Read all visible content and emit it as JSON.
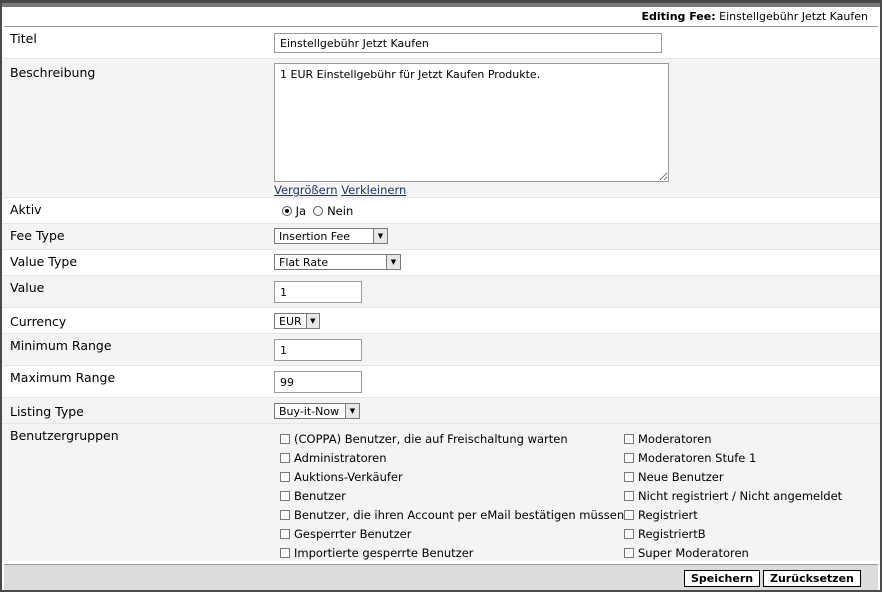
{
  "header": {
    "prefix": "Editing Fee:",
    "name": "Einstellgebühr Jetzt Kaufen"
  },
  "titel": {
    "label": "Titel",
    "value": "Einstellgebühr Jetzt Kaufen"
  },
  "beschreibung": {
    "label": "Beschreibung",
    "value": "1 EUR Einstellgebühr für Jetzt Kaufen Produkte.",
    "enlarge": "Vergrößern",
    "shrink": "Verkleinern"
  },
  "aktiv": {
    "label": "Aktiv",
    "yes": "Ja",
    "no": "Nein",
    "selected": "Ja"
  },
  "fee_type": {
    "label": "Fee Type",
    "value": "Insertion Fee"
  },
  "value_type": {
    "label": "Value Type",
    "value": "Flat Rate"
  },
  "value": {
    "label": "Value",
    "value": "1"
  },
  "currency": {
    "label": "Currency",
    "value": "EUR"
  },
  "min_range": {
    "label": "Minimum Range",
    "value": "1"
  },
  "max_range": {
    "label": "Maximum Range",
    "value": "99"
  },
  "listing_type": {
    "label": "Listing Type",
    "value": "Buy-it-Now"
  },
  "groups": {
    "label": "Benutzergruppen",
    "left": [
      "(COPPA) Benutzer, die auf Freischaltung warten",
      "Administratoren",
      "Auktions-Verkäufer",
      "Benutzer",
      "Benutzer, die ihren Account per eMail bestätigen müssen",
      "Gesperrter Benutzer",
      "Importierte gesperrte Benutzer"
    ],
    "right": [
      "Moderatoren",
      "Moderatoren Stufe 1",
      "Neue Benutzer",
      "Nicht registriert / Nicht angemeldet",
      "Registriert",
      "RegistriertB",
      "Super Moderatoren"
    ]
  },
  "buttons": {
    "save": "Speichern",
    "reset": "Zurücksetzen"
  }
}
